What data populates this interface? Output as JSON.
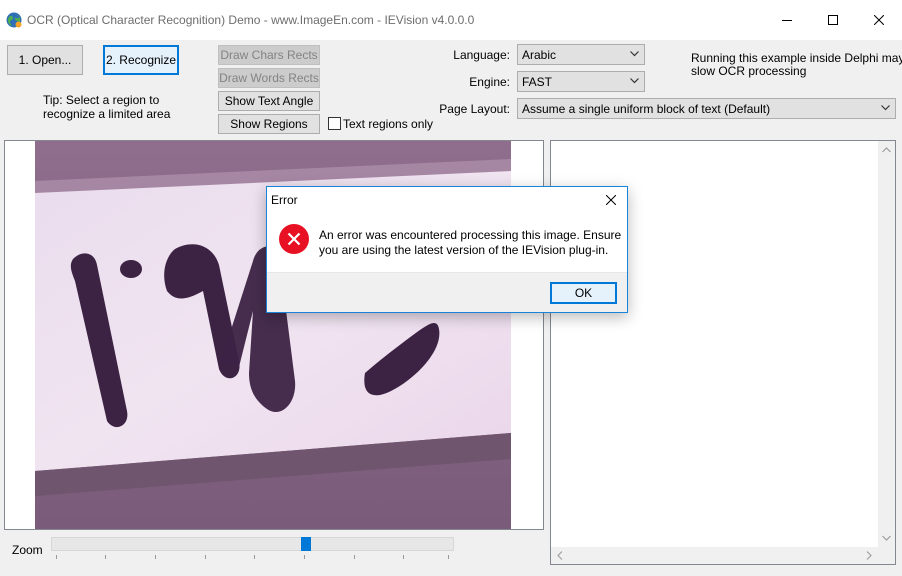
{
  "window": {
    "title": "OCR (Optical Character Recognition) Demo - www.ImageEn.com - IEVision v4.0.0.0",
    "app_icon": "globe-icon",
    "controls": [
      "minimize-icon",
      "maximize-icon",
      "close-icon"
    ]
  },
  "toolbar": {
    "open_label": "1. Open...",
    "recognize_label": "2. Recognize",
    "draw_chars_label": "Draw Chars Rects",
    "draw_words_label": "Draw Words Rects",
    "show_angle_label": "Show Text Angle",
    "show_regions_label": "Show Regions",
    "text_regions_only_label": "Text regions only",
    "text_regions_only_checked": false,
    "tip_line1": "Tip: Select a region to",
    "tip_line2": "recognize a limited area"
  },
  "options": {
    "language_label": "Language:",
    "language_value": "Arabic",
    "engine_label": "Engine:",
    "engine_value": "FAST",
    "page_layout_label": "Page Layout:",
    "page_layout_value": "Assume a single uniform block of text (Default)"
  },
  "notice": {
    "line1": "Running this example inside Delphi may",
    "line2": "slow OCR processing"
  },
  "zoom": {
    "label": "Zoom",
    "value_fraction": 0.5
  },
  "dialog": {
    "title": "Error",
    "message": "An error was encountered processing this image. Ensure you are using the latest version of the IEVision plug-in.",
    "ok_label": "OK",
    "icon": "error-icon"
  },
  "colors": {
    "accent": "#0078d7",
    "error": "#e81123"
  }
}
